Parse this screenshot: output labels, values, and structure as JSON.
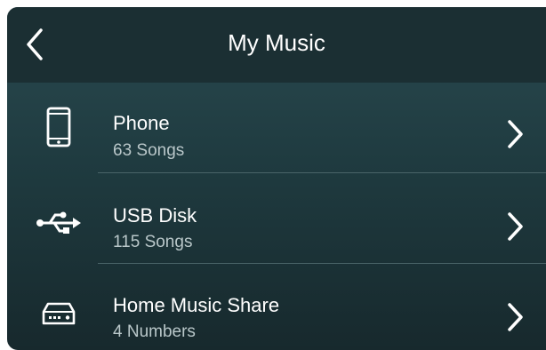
{
  "header": {
    "title": "My Music"
  },
  "icons": {
    "back": "chevron-left-icon",
    "next": "chevron-right-icon"
  },
  "sources": [
    {
      "name": "Phone",
      "count": "63  Songs",
      "icon": "smartphone-icon"
    },
    {
      "name": "USB Disk",
      "count": "115  Songs",
      "icon": "usb-icon"
    },
    {
      "name": "Home Music Share",
      "count": "4 Numbers",
      "icon": "network-storage-icon"
    }
  ],
  "colors": {
    "header_bg": "#1b2f33",
    "screen_bg_top": "#2a4a50",
    "screen_bg_bottom": "#17292d",
    "text_primary": "#ffffff",
    "text_secondary": "#b9c7c9"
  }
}
